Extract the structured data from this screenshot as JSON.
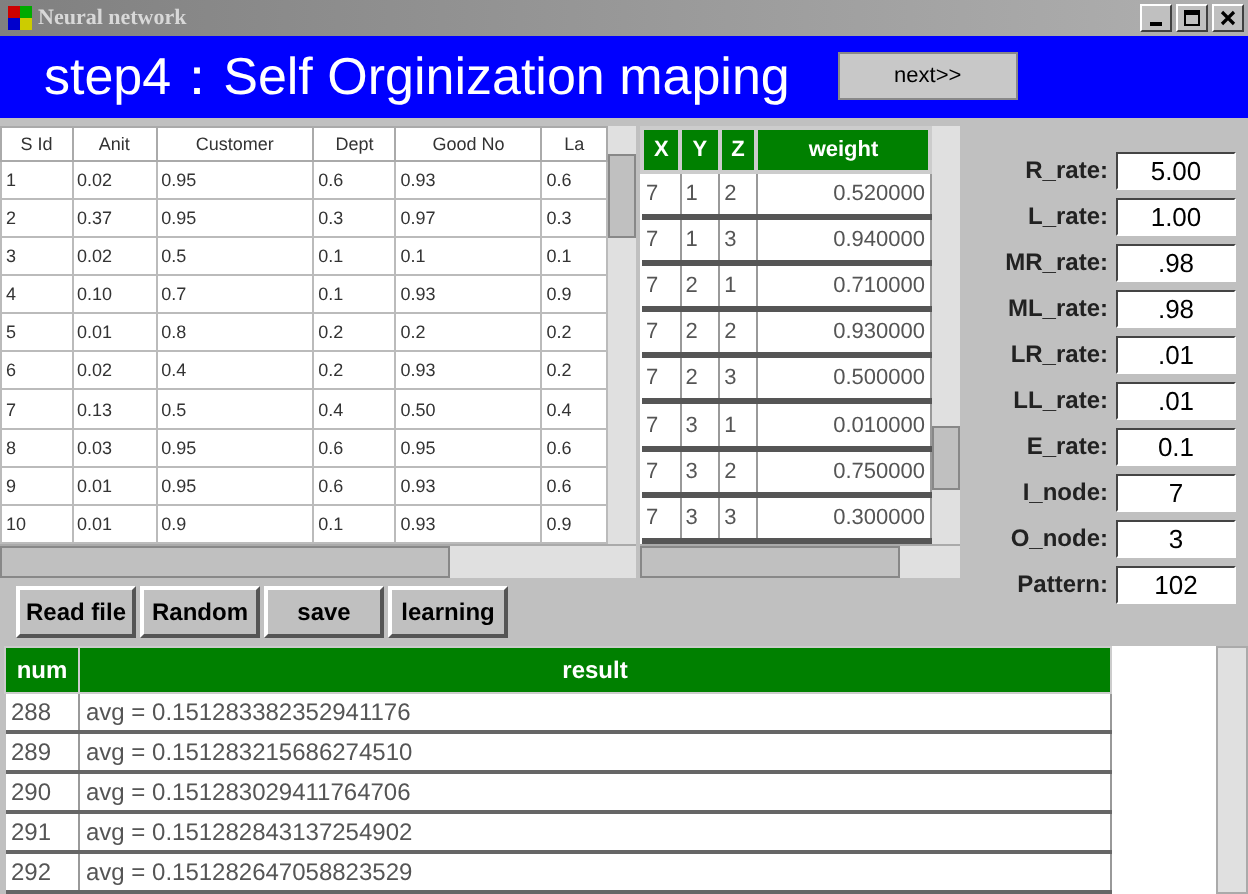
{
  "window": {
    "title": "Neural network"
  },
  "banner": {
    "title": "step4：Self Orginization maping",
    "next_button": "next>>"
  },
  "data_table": {
    "columns": [
      "S Id",
      "Anit",
      "Customer",
      "Dept",
      "Good No",
      "La"
    ],
    "rows": [
      [
        "1",
        "0.02",
        "0.95",
        "0.6",
        "0.93",
        "0.6"
      ],
      [
        "2",
        "0.37",
        "0.95",
        "0.3",
        "0.97",
        "0.3"
      ],
      [
        "3",
        "0.02",
        "0.5",
        "0.1",
        "0.1",
        "0.1"
      ],
      [
        "4",
        "0.10",
        "0.7",
        "0.1",
        "0.93",
        "0.9"
      ],
      [
        "5",
        "0.01",
        "0.8",
        "0.2",
        "0.2",
        "0.2"
      ],
      [
        "6",
        "0.02",
        "0.4",
        "0.2",
        "0.93",
        "0.2"
      ],
      [
        "7",
        "0.13",
        "0.5",
        "0.4",
        "0.50",
        "0.4"
      ],
      [
        "8",
        "0.03",
        "0.95",
        "0.6",
        "0.95",
        "0.6"
      ],
      [
        "9",
        "0.01",
        "0.95",
        "0.6",
        "0.93",
        "0.6"
      ],
      [
        "10",
        "0.01",
        "0.9",
        "0.1",
        "0.93",
        "0.9"
      ]
    ]
  },
  "weight_table": {
    "columns": [
      "X",
      "Y",
      "Z",
      "weight"
    ],
    "rows": [
      [
        "7",
        "1",
        "2",
        "0.520000"
      ],
      [
        "7",
        "1",
        "3",
        "0.940000"
      ],
      [
        "7",
        "2",
        "1",
        "0.710000"
      ],
      [
        "7",
        "2",
        "2",
        "0.930000"
      ],
      [
        "7",
        "2",
        "3",
        "0.500000"
      ],
      [
        "7",
        "3",
        "1",
        "0.010000"
      ],
      [
        "7",
        "3",
        "2",
        "0.750000"
      ],
      [
        "7",
        "3",
        "3",
        "0.300000"
      ]
    ]
  },
  "parameters": [
    {
      "label": "R_rate:",
      "value": "5.00"
    },
    {
      "label": "L_rate:",
      "value": "1.00"
    },
    {
      "label": "MR_rate:",
      "value": ".98"
    },
    {
      "label": "ML_rate:",
      "value": ".98"
    },
    {
      "label": "LR_rate:",
      "value": ".01"
    },
    {
      "label": "LL_rate:",
      "value": ".01"
    },
    {
      "label": "E_rate:",
      "value": "0.1"
    },
    {
      "label": "I_node:",
      "value": "7"
    },
    {
      "label": "O_node:",
      "value": "3"
    },
    {
      "label": "Pattern:",
      "value": "102"
    }
  ],
  "buttons": [
    "Read file",
    "Random",
    "save",
    "learning"
  ],
  "result_table": {
    "columns": [
      "num",
      "result"
    ],
    "rows": [
      [
        "288",
        "avg = 0.151283382352941176"
      ],
      [
        "289",
        "avg = 0.151283215686274510"
      ],
      [
        "290",
        "avg = 0.151283029411764706"
      ],
      [
        "291",
        "avg = 0.151282843137254902"
      ],
      [
        "292",
        "avg = 0.151282647058823529"
      ]
    ]
  }
}
